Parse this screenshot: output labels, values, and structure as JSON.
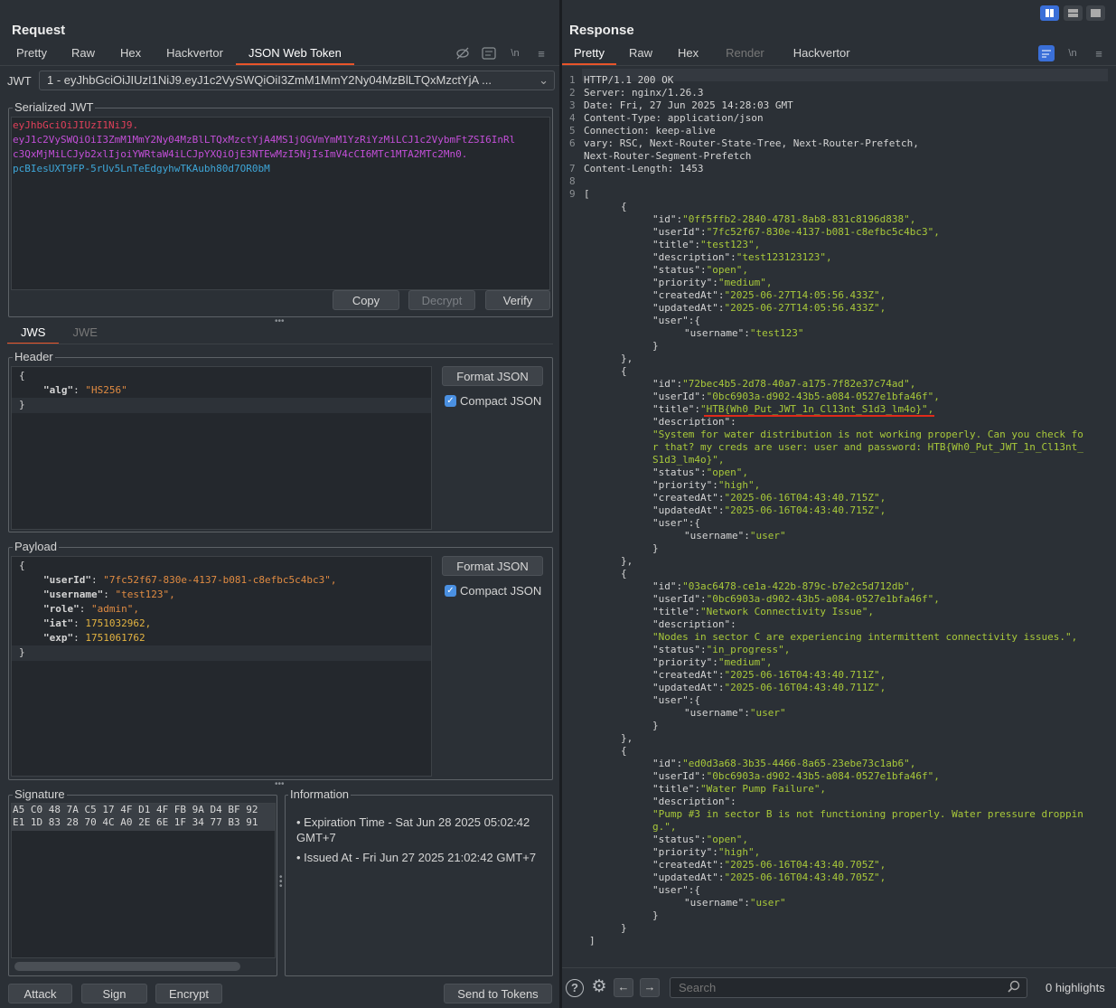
{
  "request": {
    "title": "Request",
    "tabs": [
      "Pretty",
      "Raw",
      "Hex",
      "Hackvertor",
      "JSON Web Token"
    ],
    "jwt_label": "JWT",
    "jwt_select": "1 - eyJhbGciOiJIUzI1NiJ9.eyJ1c2VySWQiOiI3ZmM1MmY2Ny04MzBlLTQxMzctYjA ...",
    "serialized_legend": "Serialized JWT",
    "serialized": {
      "header": "eyJhbGciOiJIUzI1NiJ9.",
      "payload1": "eyJ1c2VySWQiOiI3ZmM1MmY2Ny04MzBlLTQxMzctYjA4MS1jOGVmYmM1YzRiYzMiLCJ1c2VybmFtZSI6InRl",
      "payload2": "c3QxMjMiLCJyb2xlIjoiYWRtaW4iLCJpYXQiOjE3NTEwMzI5NjIsImV4cCI6MTc1MTA2MTc2Mn0.",
      "signature": "pcBIesUXT9FP-5rUv5LnTeEdgyhwTKAubh80d7OR0bM"
    },
    "buttons": {
      "copy": "Copy",
      "decrypt": "Decrypt",
      "verify": "Verify"
    },
    "sub_tabs": [
      "JWS",
      "JWE"
    ],
    "header_legend": "Header",
    "header_lines": [
      {
        "t": "{"
      },
      {
        "k": "\"alg\"",
        "v": "\"HS256\""
      },
      {
        "t": "}"
      }
    ],
    "format_json": "Format JSON",
    "compact_json": "Compact JSON",
    "payload_legend": "Payload",
    "payload": {
      "open": "{",
      "userId_k": "\"userId\"",
      "userId_v": "\"7fc52f67-830e-4137-b081-c8efbc5c4bc3\",",
      "username_k": "\"username\"",
      "username_v": "\"test123\",",
      "role_k": "\"role\"",
      "role_v": "\"admin\",",
      "iat_k": "\"iat\"",
      "iat_v": "1751032962,",
      "exp_k": "\"exp\"",
      "exp_v": "1751061762",
      "close": "}"
    },
    "signature_legend": "Signature",
    "signature_hex": [
      "A5 C0 48 7A C5 17 4F D1 4F FB 9A D4 BF 92",
      "E1 1D 83 28 70 4C A0 2E 6E 1F 34 77 B3 91"
    ],
    "info_legend": "Information",
    "info": [
      "Expiration Time - Sat Jun 28 2025 05:02:42 GMT+7",
      "Issued At - Fri Jun 27 2025 21:02:42 GMT+7"
    ],
    "bottom_buttons": {
      "attack": "Attack",
      "sign": "Sign",
      "encrypt": "Encrypt",
      "send": "Send to Tokens"
    }
  },
  "response": {
    "title": "Response",
    "tabs": [
      "Pretty",
      "Raw",
      "Hex",
      "Render",
      "Hackvertor"
    ],
    "headers": [
      {
        "n": "1",
        "t": "HTTP/1.1 200 OK"
      },
      {
        "n": "2",
        "t": "Server: nginx/1.26.3"
      },
      {
        "n": "3",
        "t": "Date: Fri, 27 Jun 2025 14:28:03 GMT"
      },
      {
        "n": "4",
        "t": "Content-Type: application/json"
      },
      {
        "n": "5",
        "t": "Connection: keep-alive"
      },
      {
        "n": "6",
        "t": "vary: RSC, Next-Router-State-Tree, Next-Router-Prefetch,"
      },
      {
        "n": "",
        "t": "Next-Router-Segment-Prefetch"
      },
      {
        "n": "7",
        "t": "Content-Length: 1453"
      },
      {
        "n": "8",
        "t": ""
      },
      {
        "n": "9",
        "t": "["
      }
    ],
    "body": [
      {
        "i": 1,
        "t": "{"
      },
      {
        "i": 2,
        "k": "\"id\":",
        "v": "\"0ff5ffb2-2840-4781-8ab8-831c8196d838\","
      },
      {
        "i": 2,
        "k": "\"userId\":",
        "v": "\"7fc52f67-830e-4137-b081-c8efbc5c4bc3\","
      },
      {
        "i": 2,
        "k": "\"title\":",
        "v": "\"test123\","
      },
      {
        "i": 2,
        "k": "\"description\":",
        "v": "\"test123123123\","
      },
      {
        "i": 2,
        "k": "\"status\":",
        "v": "\"open\","
      },
      {
        "i": 2,
        "k": "\"priority\":",
        "v": "\"medium\","
      },
      {
        "i": 2,
        "k": "\"createdAt\":",
        "v": "\"2025-06-27T14:05:56.433Z\","
      },
      {
        "i": 2,
        "k": "\"updatedAt\":",
        "v": "\"2025-06-27T14:05:56.433Z\","
      },
      {
        "i": 2,
        "k": "\"user\":",
        "v": "{"
      },
      {
        "i": 3,
        "k": "\"username\":",
        "v": "\"test123\""
      },
      {
        "i": 2,
        "t": "}"
      },
      {
        "i": 1,
        "t": "},"
      },
      {
        "i": 1,
        "t": "{"
      },
      {
        "i": 2,
        "k": "\"id\":",
        "v": "\"72bec4b5-2d78-40a7-a175-7f82e37c74ad\","
      },
      {
        "i": 2,
        "k": "\"userId\":",
        "v": "\"0bc6903a-d902-43b5-a084-0527e1bfa46f\","
      },
      {
        "i": 2,
        "k": "\"title\":",
        "v": "\"HTB{Wh0_Put_JWT_1n_Cl13nt_S1d3_lm4o}\",",
        "hl": true
      },
      {
        "i": 2,
        "k": "\"description\":",
        "v": ""
      },
      {
        "i": 2,
        "v": "\"System for water distribution is not working properly. Can you check fo"
      },
      {
        "i": 2,
        "v": "r that? my creds are user: user and password: HTB{Wh0_Put_JWT_1n_Cl13nt_"
      },
      {
        "i": 2,
        "v": "S1d3_lm4o}\","
      },
      {
        "i": 2,
        "k": "\"status\":",
        "v": "\"open\","
      },
      {
        "i": 2,
        "k": "\"priority\":",
        "v": "\"high\","
      },
      {
        "i": 2,
        "k": "\"createdAt\":",
        "v": "\"2025-06-16T04:43:40.715Z\","
      },
      {
        "i": 2,
        "k": "\"updatedAt\":",
        "v": "\"2025-06-16T04:43:40.715Z\","
      },
      {
        "i": 2,
        "k": "\"user\":",
        "v": "{"
      },
      {
        "i": 3,
        "k": "\"username\":",
        "v": "\"user\""
      },
      {
        "i": 2,
        "t": "}"
      },
      {
        "i": 1,
        "t": "},"
      },
      {
        "i": 1,
        "t": "{"
      },
      {
        "i": 2,
        "k": "\"id\":",
        "v": "\"03ac6478-ce1a-422b-879c-b7e2c5d712db\","
      },
      {
        "i": 2,
        "k": "\"userId\":",
        "v": "\"0bc6903a-d902-43b5-a084-0527e1bfa46f\","
      },
      {
        "i": 2,
        "k": "\"title\":",
        "v": "\"Network Connectivity Issue\","
      },
      {
        "i": 2,
        "k": "\"description\":",
        "v": ""
      },
      {
        "i": 2,
        "v": "\"Nodes in sector C are experiencing intermittent connectivity issues.\","
      },
      {
        "i": 2,
        "k": "\"status\":",
        "v": "\"in_progress\","
      },
      {
        "i": 2,
        "k": "\"priority\":",
        "v": "\"medium\","
      },
      {
        "i": 2,
        "k": "\"createdAt\":",
        "v": "\"2025-06-16T04:43:40.711Z\","
      },
      {
        "i": 2,
        "k": "\"updatedAt\":",
        "v": "\"2025-06-16T04:43:40.711Z\","
      },
      {
        "i": 2,
        "k": "\"user\":",
        "v": "{"
      },
      {
        "i": 3,
        "k": "\"username\":",
        "v": "\"user\""
      },
      {
        "i": 2,
        "t": "}"
      },
      {
        "i": 1,
        "t": "},"
      },
      {
        "i": 1,
        "t": "{"
      },
      {
        "i": 2,
        "k": "\"id\":",
        "v": "\"ed0d3a68-3b35-4466-8a65-23ebe73c1ab6\","
      },
      {
        "i": 2,
        "k": "\"userId\":",
        "v": "\"0bc6903a-d902-43b5-a084-0527e1bfa46f\","
      },
      {
        "i": 2,
        "k": "\"title\":",
        "v": "\"Water Pump Failure\","
      },
      {
        "i": 2,
        "k": "\"description\":",
        "v": ""
      },
      {
        "i": 2,
        "v": "\"Pump #3 in sector B is not functioning properly. Water pressure droppin"
      },
      {
        "i": 2,
        "v": "g.\","
      },
      {
        "i": 2,
        "k": "\"status\":",
        "v": "\"open\","
      },
      {
        "i": 2,
        "k": "\"priority\":",
        "v": "\"high\","
      },
      {
        "i": 2,
        "k": "\"createdAt\":",
        "v": "\"2025-06-16T04:43:40.705Z\","
      },
      {
        "i": 2,
        "k": "\"updatedAt\":",
        "v": "\"2025-06-16T04:43:40.705Z\","
      },
      {
        "i": 2,
        "k": "\"user\":",
        "v": "{"
      },
      {
        "i": 3,
        "k": "\"username\":",
        "v": "\"user\""
      },
      {
        "i": 2,
        "t": "}"
      },
      {
        "i": 1,
        "t": "}"
      },
      {
        "i": 0,
        "t": "]"
      }
    ],
    "search_placeholder": "Search",
    "highlights": "0 highlights"
  },
  "colors": {
    "accent": "#e8542a",
    "jwt_header": "#e0405a",
    "jwt_payload": "#c34fd8",
    "jwt_signature": "#3ea6d8",
    "json_value": "#a8c83a",
    "highlight_underline": "#e02a1a"
  }
}
